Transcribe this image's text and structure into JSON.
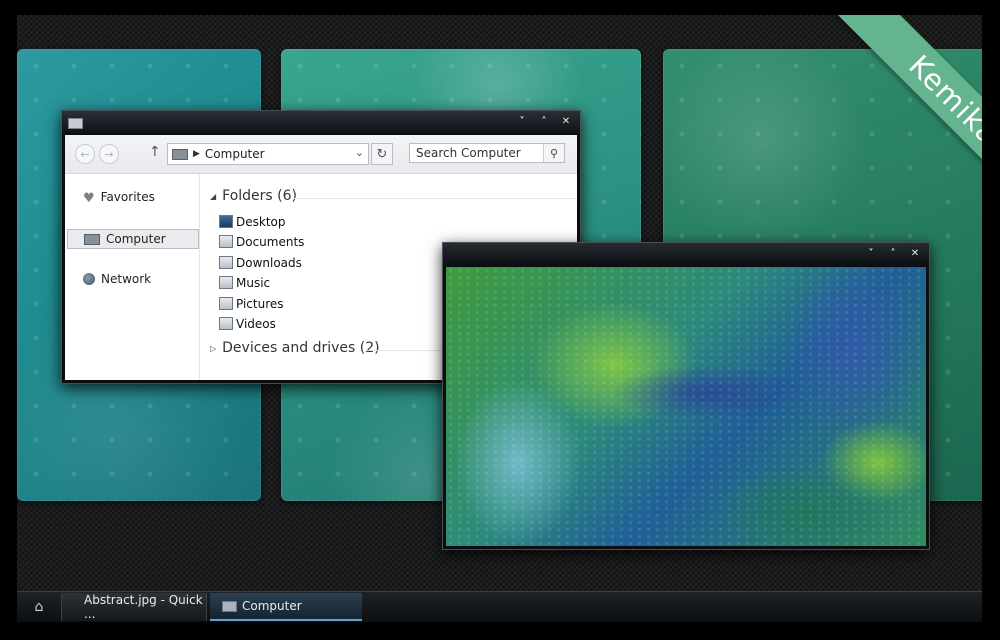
{
  "ribbon_text": "Kemikal",
  "explorer": {
    "address": "Computer",
    "search_placeholder": "Search Computer",
    "nav": [
      "Favorites",
      "Computer",
      "Network"
    ],
    "folders_header": "Folders (6)",
    "folders": [
      "Desktop",
      "Documents",
      "Downloads",
      "Music",
      "Pictures",
      "Videos"
    ],
    "devices_header": "Devices and drives (2)"
  },
  "taskbar": {
    "items": [
      "Abstract.jpg - Quick ...",
      "Computer"
    ]
  },
  "colors": {
    "ribbon": "#63b48f",
    "accent": "#5aa3d6"
  }
}
